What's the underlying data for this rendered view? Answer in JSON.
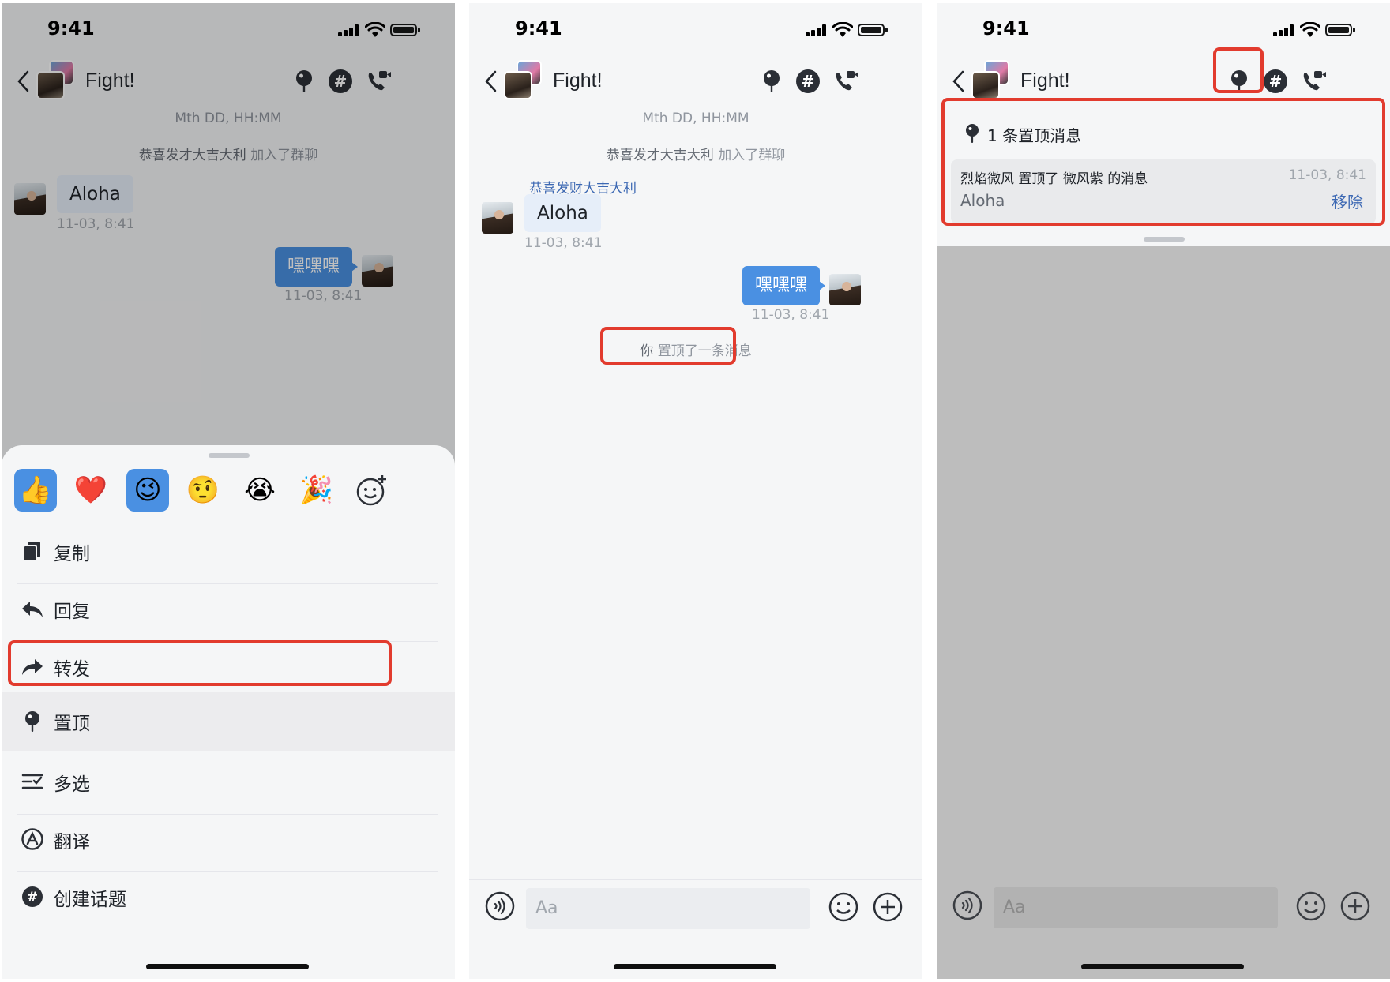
{
  "status_time": "9:41",
  "chat_title": "Fight!",
  "timestamp_header": "Mth DD, HH:MM",
  "join_notice": {
    "name": "恭喜发才大吉大利",
    "action": "加入了群聊"
  },
  "incoming": {
    "sender": "恭喜发财大吉大利",
    "text": "Aloha",
    "time": "11-03, 8:41"
  },
  "outgoing": {
    "text": "嘿嘿嘿",
    "time": "11-03, 8:41"
  },
  "reactions": [
    {
      "name": "thumbs-up",
      "glyph": "👍"
    },
    {
      "name": "heart",
      "glyph": "❤️"
    },
    {
      "name": "wink",
      "glyph": "😉"
    },
    {
      "name": "raised-eyebrow",
      "glyph": "🤨"
    },
    {
      "name": "crying",
      "glyph": "😭"
    },
    {
      "name": "party-popper",
      "glyph": "🎉"
    },
    {
      "name": "add-reaction",
      "glyph": "☺"
    }
  ],
  "menu": {
    "copy": "复制",
    "reply": "回复",
    "forward": "转发",
    "pin": "置顶",
    "multiselect": "多选",
    "translate": "翻译",
    "create_topic": "创建话题"
  },
  "pin_notice": {
    "actor": "你",
    "action": "置顶了一条消息"
  },
  "input_placeholder": "Aa",
  "pinned_panel": {
    "header": "1 条置顶消息",
    "pinner": "烈焰微风",
    "action": "置顶了",
    "owner": "微风紫",
    "suffix": "的消息",
    "time": "11-03, 8:41",
    "message": "Aloha",
    "remove": "移除"
  },
  "colors": {
    "accent": "#4a90e2",
    "highlight": "#e23b2e",
    "link": "#3c68b3"
  },
  "icons": [
    "back-icon",
    "pin-icon",
    "topic-hash-icon",
    "video-call-icon",
    "voice-icon",
    "emoji-icon",
    "plus-icon",
    "copy-icon",
    "reply-icon",
    "forward-icon",
    "multiselect-icon",
    "translate-icon"
  ]
}
